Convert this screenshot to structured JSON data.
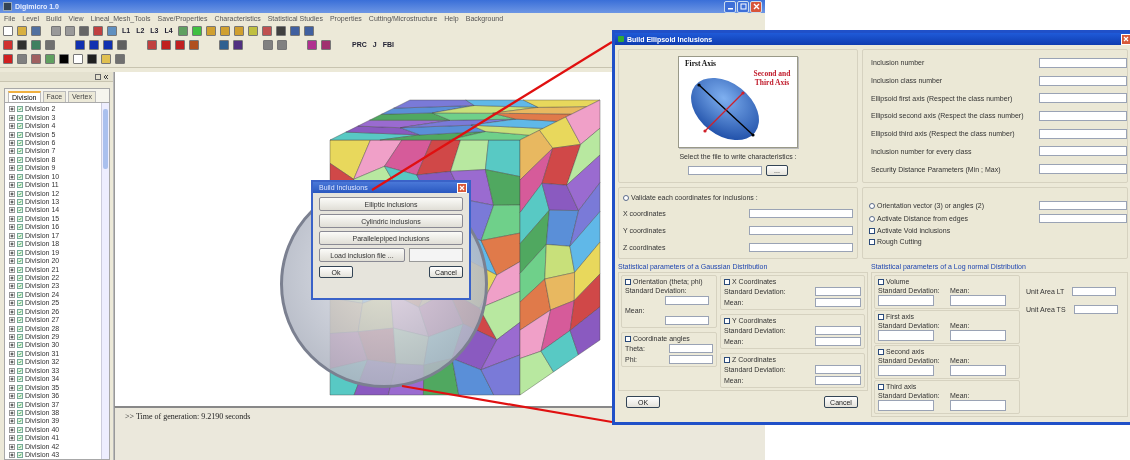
{
  "window": {
    "title": "Digimicro 1.0"
  },
  "menu": [
    "File",
    "Level",
    "Build",
    "View",
    "Lineal_Mesh_Tools",
    "Save/Properties",
    "Characteristics",
    "Statistical Studies",
    "Properties",
    "Cutting/Microstructure",
    "Help",
    "Background"
  ],
  "toolbar": {
    "level_buttons": [
      "L1",
      "L2",
      "L3",
      "L4"
    ],
    "text_buttons": [
      "PRC",
      "J",
      "FBI"
    ]
  },
  "tree_tabs": [
    {
      "label": "Division",
      "selected": true
    },
    {
      "label": "Face",
      "selected": false
    },
    {
      "label": "Vertex",
      "selected": false
    }
  ],
  "tree_items": [
    {
      "label": "Division 2",
      "checked": true,
      "expanded": false
    },
    {
      "label": "Division 3",
      "checked": true,
      "expanded": false
    },
    {
      "label": "Division 4",
      "checked": true,
      "expanded": false
    },
    {
      "label": "Division 5",
      "checked": true,
      "expanded": false
    },
    {
      "label": "Division 6",
      "checked": true,
      "expanded": false
    },
    {
      "label": "Division 7",
      "checked": true,
      "expanded": false
    },
    {
      "label": "Division 8",
      "checked": true,
      "expanded": false
    },
    {
      "label": "Division 9",
      "checked": true,
      "expanded": false
    },
    {
      "label": "Division 10",
      "checked": true,
      "expanded": false
    },
    {
      "label": "Division 11",
      "checked": true,
      "expanded": false
    },
    {
      "label": "Division 12",
      "checked": true,
      "expanded": false
    },
    {
      "label": "Division 13",
      "checked": true,
      "expanded": false
    },
    {
      "label": "Division 14",
      "checked": true,
      "expanded": false
    },
    {
      "label": "Division 15",
      "checked": true,
      "expanded": false
    },
    {
      "label": "Division 16",
      "checked": true,
      "expanded": false
    },
    {
      "label": "Division 17",
      "checked": true,
      "expanded": false
    },
    {
      "label": "Division 18",
      "checked": true,
      "expanded": false
    },
    {
      "label": "Division 19",
      "checked": true,
      "expanded": false
    },
    {
      "label": "Division 20",
      "checked": true,
      "expanded": false
    },
    {
      "label": "Division 21",
      "checked": true,
      "expanded": false
    },
    {
      "label": "Division 22",
      "checked": true,
      "expanded": false
    },
    {
      "label": "Division 23",
      "checked": true,
      "expanded": false
    },
    {
      "label": "Division 24",
      "checked": true,
      "expanded": false
    },
    {
      "label": "Division 25",
      "checked": true,
      "expanded": false
    },
    {
      "label": "Division 26",
      "checked": true,
      "expanded": false
    },
    {
      "label": "Division 27",
      "checked": true,
      "expanded": false
    },
    {
      "label": "Division 28",
      "checked": true,
      "expanded": false
    },
    {
      "label": "Division 29",
      "checked": true,
      "expanded": false
    },
    {
      "label": "Division 30",
      "checked": true,
      "expanded": false
    },
    {
      "label": "Division 31",
      "checked": true,
      "expanded": false
    },
    {
      "label": "Division 32",
      "checked": true,
      "expanded": false
    },
    {
      "label": "Division 33",
      "checked": true,
      "expanded": false
    },
    {
      "label": "Division 34",
      "checked": true,
      "expanded": false
    },
    {
      "label": "Division 35",
      "checked": true,
      "expanded": false
    },
    {
      "label": "Division 36",
      "checked": true,
      "expanded": false
    },
    {
      "label": "Division 37",
      "checked": true,
      "expanded": false
    },
    {
      "label": "Division 38",
      "checked": true,
      "expanded": false
    },
    {
      "label": "Division 39",
      "checked": true,
      "expanded": false
    },
    {
      "label": "Division 40",
      "checked": true,
      "expanded": false
    },
    {
      "label": "Division 41",
      "checked": true,
      "expanded": false
    },
    {
      "label": "Division 42",
      "checked": true,
      "expanded": false
    },
    {
      "label": "Division 43",
      "checked": true,
      "expanded": false
    }
  ],
  "output_lines": [
    ">> Time of generation: 9.2190 seconds"
  ],
  "small_dialog": {
    "title": "Build Inclusions",
    "buttons": [
      "Elliptic inclusions",
      "Cylindric inclusions",
      "Parallelepiped inclusions"
    ],
    "load_button": "Load inclusion file ...",
    "ok_button": "Ok",
    "cancel_button": "Cancel"
  },
  "dialog": {
    "title": "Build Ellipsoid Inclusions",
    "figure_labels": [
      "First Axis",
      "Second and Third Axis"
    ],
    "file_label": "Select the file to write characteristics :",
    "browse_button": "...",
    "fields": [
      "Inclusion number",
      "Inclusion class number",
      "Ellipsoid first axis (Respect the class number)",
      "Ellipsoid second axis (Respect the class number)",
      "Ellipsoid third axis (Respect the class number)",
      "Inclusion number for every class",
      "Security Distance Parameters (Min ; Max)"
    ],
    "validate": {
      "label": "Validate each coordinates for inclusions :",
      "checked": false
    },
    "coordinates": [
      "X coordinates",
      "Y coordinates",
      "Z coordinates"
    ],
    "options": [
      {
        "kind": "radio",
        "label": "Orientation vector (3) or angles (2)",
        "checked": false
      },
      {
        "kind": "radio",
        "label": "Activate Distance from edges",
        "checked": false
      },
      {
        "kind": "checkbox",
        "label": "Activate Void inclusions",
        "checked": false
      },
      {
        "kind": "checkbox",
        "label": "Rough Cutting",
        "checked": false
      }
    ],
    "gaussian": {
      "title": "Statistical parameters of a Gaussian Distribution",
      "orientation": {
        "label": "Orientation (theta; phi)",
        "checked": false,
        "sd_label": "Standard Deviation:",
        "mean_label": "Mean:"
      },
      "angles": {
        "label": "Coordinate angles",
        "checked": false,
        "theta_label": "Theta:",
        "phi_label": "Phi:"
      },
      "coordinates": [
        {
          "label": "X Coordinates",
          "checked": false,
          "sd_label": "Standard Deviation:",
          "mean_label": "Mean:"
        },
        {
          "label": "Y Coordinates",
          "checked": false,
          "sd_label": "Standard Deviation:",
          "mean_label": "Mean:"
        },
        {
          "label": "Z Coordinates",
          "checked": false,
          "sd_label": "Standard Deviation:",
          "mean_label": "Mean:"
        }
      ]
    },
    "lognormal": {
      "title": "Statistical parameters of a Log normal Distribution",
      "groups": [
        {
          "label": "Volume",
          "checked": false,
          "sd_label": "Standard Deviation:",
          "mean_label": "Mean:"
        },
        {
          "label": "First axis",
          "checked": false,
          "sd_label": "Standard Deviation:",
          "mean_label": "Mean:"
        },
        {
          "label": "Second axis",
          "checked": false,
          "sd_label": "Standard Deviation:",
          "mean_label": "Mean:"
        },
        {
          "label": "Third axis",
          "checked": false,
          "sd_label": "Standard Deviation:",
          "mean_label": "Mean:"
        }
      ],
      "units": [
        "Unit Area LT",
        "Unit Area TS"
      ]
    },
    "ok_button": "OK",
    "cancel_button": "Cancel"
  }
}
